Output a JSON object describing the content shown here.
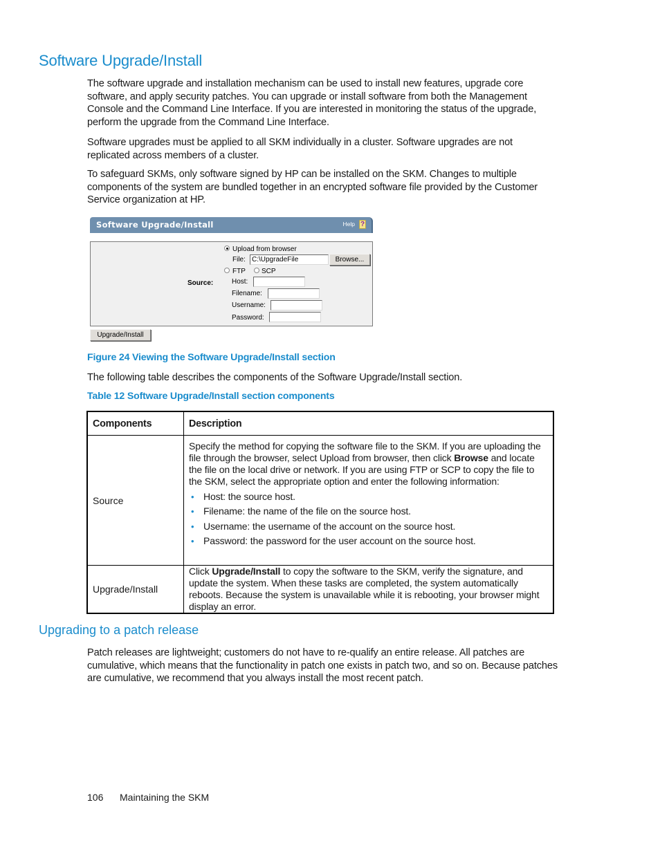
{
  "section": {
    "title": "Software Upgrade/Install",
    "paragraphs": [
      "The software upgrade and installation mechanism can be used to install new features, upgrade core software, and apply security patches. You can upgrade or install software from both the Management Console and the Command Line Interface. If you are interested in monitoring the status of the upgrade, perform the upgrade from the Command Line Interface.",
      "Software upgrades must be applied to all SKM individually in a cluster. Software upgrades are not replicated across members of a cluster.",
      "To safeguard SKMs, only software signed by HP can be installed on the SKM. Changes to multiple components of the system are bundled together in an encrypted software file provided by the Customer Service organization at HP."
    ]
  },
  "figure": {
    "panel_title": "Software Upgrade/Install",
    "help_label": "Help",
    "help_icon": "question-mark-icon",
    "source_label": "Source:",
    "upload_option": "Upload from browser",
    "upload_checked": true,
    "file_label": "File:",
    "file_value": "C:\\UpgradeFile",
    "browse_label": "Browse...",
    "ftp_label": "FTP",
    "scp_label": "SCP",
    "host_label": "Host:",
    "filename_label": "Filename:",
    "username_label": "Username:",
    "password_label": "Password:",
    "host_value": "",
    "filename_value": "",
    "username_value": "",
    "password_value": "",
    "submit_label": "Upgrade/Install",
    "caption": "Figure 24 Viewing the Software Upgrade/Install section"
  },
  "intro_table_text": "The following table describes the components of the Software Upgrade/Install section.",
  "table": {
    "caption": "Table 12 Software Upgrade/Install section components",
    "headers": [
      "Components",
      "Description"
    ],
    "rows": [
      {
        "component": "Source",
        "desc_part1": "Specify the method for copying the software file to the SKM. If you are uploading the file through the browser, select Upload from browser, then click ",
        "desc_bold": "Browse",
        "desc_part2": " and locate the file on the local drive or network. If you are using FTP or SCP to copy the file to the SKM, select the appropriate option and enter the following information:",
        "bullets": [
          "Host: the source host.",
          "Filename: the name of the file on the source host.",
          "Username: the username of the account on the source host.",
          "Password: the password for the user account on the source host."
        ]
      },
      {
        "component": "Upgrade/Install",
        "desc_part1": "Click ",
        "desc_bold": "Upgrade/Install",
        "desc_part2": " to copy the software to the SKM, verify the signature, and update the system. When these tasks are completed, the system automatically reboots. Because the system is unavailable while it is rebooting, your browser might display an error."
      }
    ]
  },
  "subsection": {
    "title": "Upgrading to a patch release",
    "paragraph": "Patch releases are lightweight; customers do not have to re-qualify an entire release. All patches are cumulative, which means that the functionality in patch one exists in patch two, and so on. Because patches are cumulative, we recommend that you always install the most recent patch."
  },
  "footer": {
    "page_number": "106",
    "chapter": "Maintaining the SKM"
  },
  "colors": {
    "heading": "#1a8ccc",
    "panel_header": "#6f8fae",
    "panel_bg": "#f0f0f0"
  }
}
